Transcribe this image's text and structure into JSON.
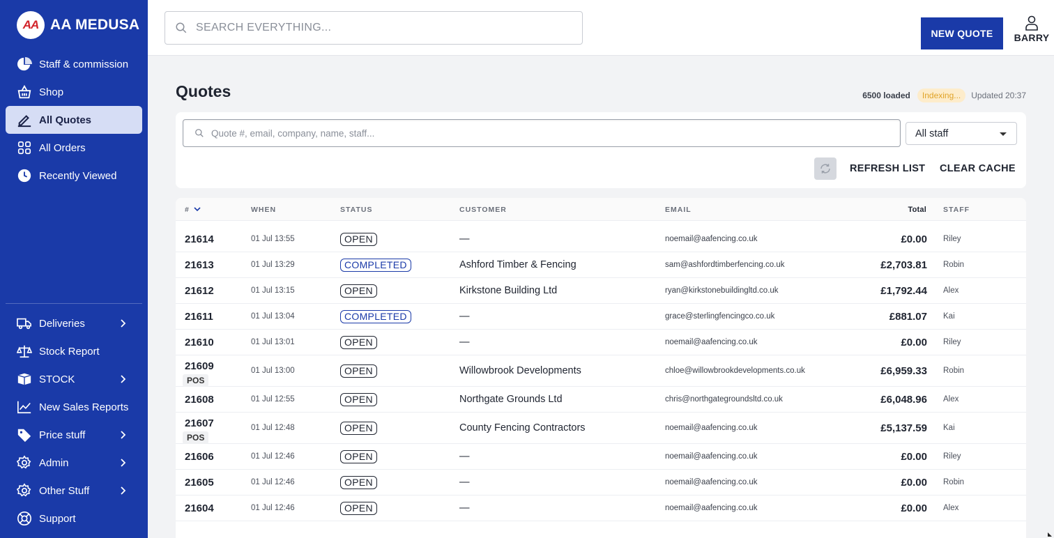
{
  "app": {
    "name": "AA MEDUSA",
    "logo_text": "AA"
  },
  "sidebar": {
    "items": [
      {
        "label": "Staff & commission",
        "icon": "pie-chart-icon",
        "active": false,
        "has_submenu": false
      },
      {
        "label": "Shop",
        "icon": "basket-icon",
        "active": false,
        "has_submenu": false
      },
      {
        "label": "All Quotes",
        "icon": "pen-icon",
        "active": true,
        "has_submenu": false
      },
      {
        "label": "All Orders",
        "icon": "grid-icon",
        "active": false,
        "has_submenu": false
      },
      {
        "label": "Recently Viewed",
        "icon": "clock-icon",
        "active": false,
        "has_submenu": false
      }
    ],
    "bottom_items": [
      {
        "label": "Deliveries",
        "icon": "truck-icon",
        "has_submenu": true
      },
      {
        "label": "Stock Report",
        "icon": "scales-icon",
        "has_submenu": false
      },
      {
        "label": "STOCK",
        "icon": "box-icon",
        "has_submenu": true
      },
      {
        "label": "New Sales Reports",
        "icon": "line-chart-icon",
        "has_submenu": false
      },
      {
        "label": "Price stuff",
        "icon": "tag-icon",
        "has_submenu": true
      },
      {
        "label": "Admin",
        "icon": "gear-icon",
        "has_submenu": true
      },
      {
        "label": "Other Stuff",
        "icon": "gear-icon",
        "has_submenu": true
      },
      {
        "label": "Support",
        "icon": "lifebuoy-icon",
        "has_submenu": false
      }
    ]
  },
  "topbar": {
    "search_placeholder": "SEARCH EVERYTHING...",
    "new_quote_label": "NEW QUOTE",
    "user_name": "BARRY"
  },
  "main": {
    "title": "Quotes",
    "loaded_text": "6500 loaded",
    "indexing_text": "Indexing...",
    "updated_text": "Updated 20:37",
    "filter": {
      "search_placeholder": "Quote #, email, company, name, staff...",
      "staff_select_value": "All staff",
      "refresh_label": "REFRESH LIST",
      "clear_cache_label": "CLEAR CACHE"
    },
    "table": {
      "columns": {
        "num": "#",
        "when": "WHEN",
        "status": "STATUS",
        "customer": "CUSTOMER",
        "email": "EMAIL",
        "total": "Total",
        "staff": "STAFF"
      },
      "rows": [
        {
          "num": "21614",
          "pos": "",
          "when": "01 Jul 13:55",
          "status": "OPEN",
          "customer": "—",
          "email": "noemail@aafencing.co.uk",
          "total": "£0.00",
          "staff": "Riley"
        },
        {
          "num": "21613",
          "pos": "",
          "when": "01 Jul 13:29",
          "status": "COMPLETED",
          "customer": "Ashford Timber & Fencing",
          "email": "sam@ashfordtimberfencing.co.uk",
          "total": "£2,703.81",
          "staff": "Robin"
        },
        {
          "num": "21612",
          "pos": "",
          "when": "01 Jul 13:15",
          "status": "OPEN",
          "customer": "Kirkstone Building Ltd",
          "email": "ryan@kirkstonebuildingltd.co.uk",
          "total": "£1,792.44",
          "staff": "Alex"
        },
        {
          "num": "21611",
          "pos": "",
          "when": "01 Jul 13:04",
          "status": "COMPLETED",
          "customer": "—",
          "email": "grace@sterlingfencingco.co.uk",
          "total": "£881.07",
          "staff": "Kai"
        },
        {
          "num": "21610",
          "pos": "",
          "when": "01 Jul 13:01",
          "status": "OPEN",
          "customer": "—",
          "email": "noemail@aafencing.co.uk",
          "total": "£0.00",
          "staff": "Riley"
        },
        {
          "num": "21609",
          "pos": "POS",
          "when": "01 Jul 13:00",
          "status": "OPEN",
          "customer": "Willowbrook Developments",
          "email": "chloe@willowbrookdevelopments.co.uk",
          "total": "£6,959.33",
          "staff": "Robin"
        },
        {
          "num": "21608",
          "pos": "",
          "when": "01 Jul 12:55",
          "status": "OPEN",
          "customer": "Northgate Grounds Ltd",
          "email": "chris@northgategroundsltd.co.uk",
          "total": "£6,048.96",
          "staff": "Alex"
        },
        {
          "num": "21607",
          "pos": "POS",
          "when": "01 Jul 12:48",
          "status": "OPEN",
          "customer": "County Fencing Contractors",
          "email": "noemail@aafencing.co.uk",
          "total": "£5,137.59",
          "staff": "Kai"
        },
        {
          "num": "21606",
          "pos": "",
          "when": "01 Jul 12:46",
          "status": "OPEN",
          "customer": "—",
          "email": "noemail@aafencing.co.uk",
          "total": "£0.00",
          "staff": "Riley"
        },
        {
          "num": "21605",
          "pos": "",
          "when": "01 Jul 12:46",
          "status": "OPEN",
          "customer": "—",
          "email": "noemail@aafencing.co.uk",
          "total": "£0.00",
          "staff": "Robin"
        },
        {
          "num": "21604",
          "pos": "",
          "when": "01 Jul 12:46",
          "status": "OPEN",
          "customer": "—",
          "email": "noemail@aafencing.co.uk",
          "total": "£0.00",
          "staff": "Alex"
        }
      ]
    }
  },
  "colors": {
    "brand": "#1a3aa8",
    "active_nav": "#d6ddf5",
    "indexing_bg": "#fdeccb",
    "indexing_text": "#e0a328"
  }
}
